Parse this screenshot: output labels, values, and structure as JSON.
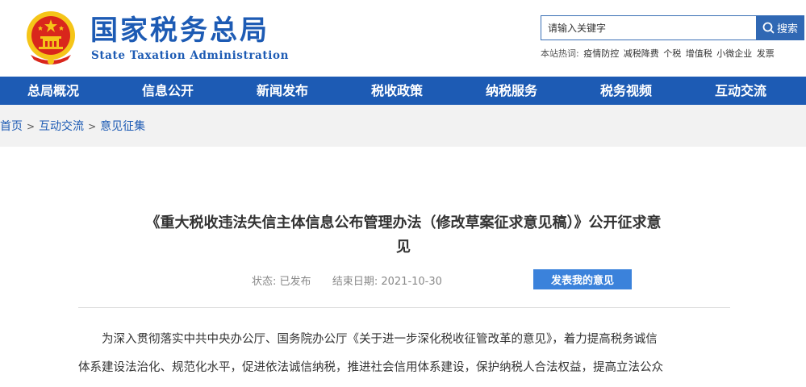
{
  "header": {
    "title": "国家税务总局",
    "subtitle": "State Taxation Administration"
  },
  "search": {
    "placeholder": "请输入关键字",
    "button_label": "搜索",
    "hot_label": "本站热词:",
    "hot_words": [
      "疫情防控",
      "减税降费",
      "个税",
      "增值税",
      "小微企业",
      "发票"
    ]
  },
  "nav": {
    "items": [
      "总局概况",
      "信息公开",
      "新闻发布",
      "税收政策",
      "纳税服务",
      "税务视频",
      "互动交流"
    ]
  },
  "breadcrumb": [
    "首页",
    "互动交流",
    "意见征集"
  ],
  "article": {
    "title_line1": "《重大税收违法失信主体信息公布管理办法（修改草案征求意见稿）》公开征求意",
    "title_line2": "见",
    "status_label": "状态:",
    "status_value": "已发布",
    "end_date_label": "结束日期:",
    "end_date_value": "2021-10-30",
    "feedback_button": "发表我的意见",
    "paragraph_line1": "为深入贯彻落实中共中央办公厅、国务院办公厅《关于进一步深化税收征管改革的意见》，着力提高税务诚信",
    "paragraph_line2": "体系建设法治化、规范化水平，促进依法诚信纳税，推进社会信用体系建设，保护纳税人合法权益，提高立法公众"
  },
  "colors": {
    "brand_blue": "#1d5bb4",
    "button_blue": "#3b82db",
    "emblem_red": "#d9261c",
    "emblem_gold": "#f5c518"
  }
}
